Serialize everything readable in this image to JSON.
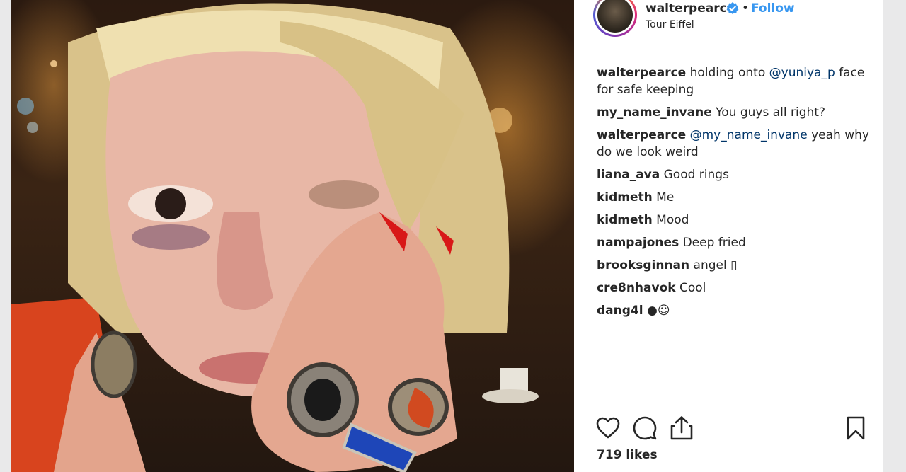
{
  "post": {
    "username": "walterpearce",
    "separator": "•",
    "follow_label": "Follow",
    "location": "Tour Eiffel",
    "likes": "719 likes"
  },
  "comments": [
    {
      "user": "walterpearce",
      "parts": [
        {
          "t": " holding onto "
        },
        {
          "m": "@yuniya_p"
        },
        {
          "t": " face for safe keeping"
        }
      ]
    },
    {
      "user": "my_name_invane",
      "parts": [
        {
          "t": " You guys all right?"
        }
      ]
    },
    {
      "user": "walterpearce",
      "parts": [
        {
          "t": " "
        },
        {
          "m": "@my_name_invane"
        },
        {
          "t": " yeah why do we look weird"
        }
      ]
    },
    {
      "user": "liana_ava",
      "parts": [
        {
          "t": " Good rings"
        }
      ]
    },
    {
      "user": "kidmeth",
      "parts": [
        {
          "t": " Me"
        }
      ]
    },
    {
      "user": "kidmeth",
      "parts": [
        {
          "t": " Mood"
        }
      ]
    },
    {
      "user": "nampajones",
      "parts": [
        {
          "t": " Deep fried"
        }
      ]
    },
    {
      "user": "brooksginnan",
      "parts": [
        {
          "t": " angel ▯"
        }
      ]
    },
    {
      "user": "cre8nhavok",
      "parts": [
        {
          "t": " Cool"
        }
      ]
    },
    {
      "user": "dang4l",
      "parts": [
        {
          "t": " ●☺"
        }
      ]
    }
  ],
  "icons": {
    "like": "heart-icon",
    "comment": "comment-icon",
    "share": "share-icon",
    "save": "bookmark-icon",
    "verified": "verified-badge-icon"
  },
  "colors": {
    "link": "#3897f0",
    "mention": "#003569",
    "text": "#262626"
  }
}
